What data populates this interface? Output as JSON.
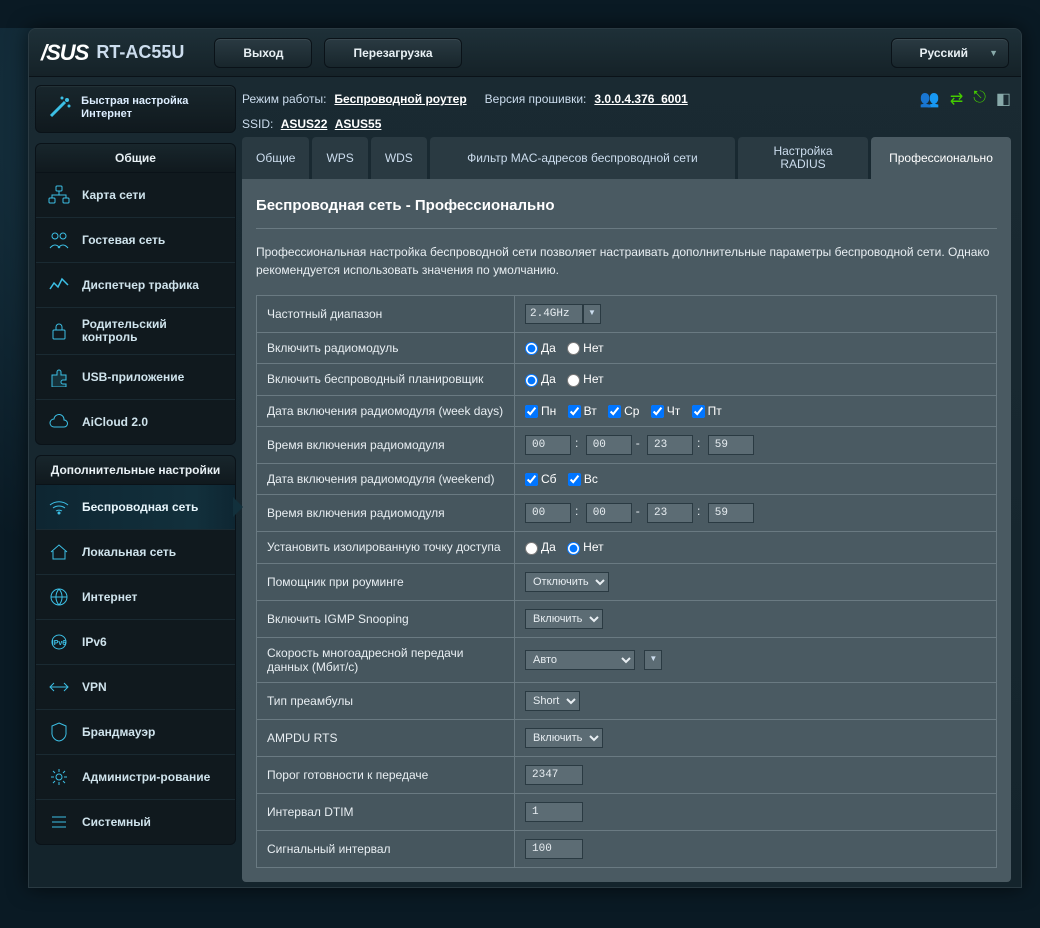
{
  "header": {
    "brand": "/SUS",
    "model": "RT-AC55U",
    "logout": "Выход",
    "reboot": "Перезагрузка",
    "lang": "Русский"
  },
  "meta": {
    "mode_label": "Режим работы:",
    "mode_value": "Беспроводной роутер",
    "fw_label": "Версия прошивки:",
    "fw_value": "3.0.0.4.376_6001",
    "ssid_label": "SSID:",
    "ssid1": "ASUS22",
    "ssid2": "ASUS55"
  },
  "quick": {
    "label": "Быстрая настройка Интернет"
  },
  "sidebar": {
    "general_head": "Общие",
    "general": [
      {
        "label": "Карта сети"
      },
      {
        "label": "Гостевая сеть"
      },
      {
        "label": "Диспетчер трафика"
      },
      {
        "label": "Родительский контроль"
      },
      {
        "label": "USB-приложение"
      },
      {
        "label": "AiCloud 2.0"
      }
    ],
    "adv_head": "Дополнительные настройки",
    "adv": [
      {
        "label": "Беспроводная сеть"
      },
      {
        "label": "Локальная сеть"
      },
      {
        "label": "Интернет"
      },
      {
        "label": "IPv6"
      },
      {
        "label": "VPN"
      },
      {
        "label": "Брандмауэр"
      },
      {
        "label": "Администри-рование"
      },
      {
        "label": "Системный"
      }
    ]
  },
  "tabs": {
    "t0": "Общие",
    "t1": "WPS",
    "t2": "WDS",
    "t3": "Фильтр MAC-адресов беспроводной сети",
    "t4": "Настройка RADIUS",
    "t5": "Профессионально"
  },
  "panel": {
    "title": "Беспроводная сеть - Профессионально",
    "desc": "Профессиональная настройка беспроводной сети позволяет настраивать дополнительные параметры беспроводной сети. Однако рекомендуется использовать значения по умолчанию."
  },
  "form": {
    "band": {
      "label": "Частотный диапазон",
      "value": "2.4GHz"
    },
    "radio": {
      "label": "Включить радиомодуль",
      "yes": "Да",
      "no": "Нет",
      "checked": "yes"
    },
    "sched": {
      "label": "Включить беспроводный планировщик",
      "yes": "Да",
      "no": "Нет",
      "checked": "yes"
    },
    "weekdays": {
      "label": "Дата включения радиомодуля (week days)",
      "d": [
        "Пн",
        "Вт",
        "Ср",
        "Чт",
        "Пт"
      ]
    },
    "weektime": {
      "label": "Время включения радиомодуля",
      "h1": "00",
      "m1": "00",
      "h2": "23",
      "m2": "59"
    },
    "weekend": {
      "label": "Дата включения радиомодуля (weekend)",
      "d": [
        "Сб",
        "Вс"
      ]
    },
    "weektime2": {
      "label": "Время включения радиомодуля",
      "h1": "00",
      "m1": "00",
      "h2": "23",
      "m2": "59"
    },
    "apiso": {
      "label": "Установить изолированную точку доступа",
      "yes": "Да",
      "no": "Нет",
      "checked": "no"
    },
    "roam": {
      "label": "Помощник при роуминге",
      "value": "Отключить"
    },
    "igmp": {
      "label": "Включить IGMP Snooping",
      "value": "Включить"
    },
    "mcast": {
      "label": "Скорость многоадресной передачи данных (Мбит/с)",
      "value": "Авто"
    },
    "preamble": {
      "label": "Тип преамбулы",
      "value": "Short"
    },
    "ampdu": {
      "label": "AMPDU RTS",
      "value": "Включить"
    },
    "rts": {
      "label": "Порог готовности к передаче",
      "value": "2347"
    },
    "dtim": {
      "label": "Интервал DTIM",
      "value": "1"
    },
    "beacon": {
      "label": "Сигнальный интервал",
      "value": "100"
    }
  }
}
